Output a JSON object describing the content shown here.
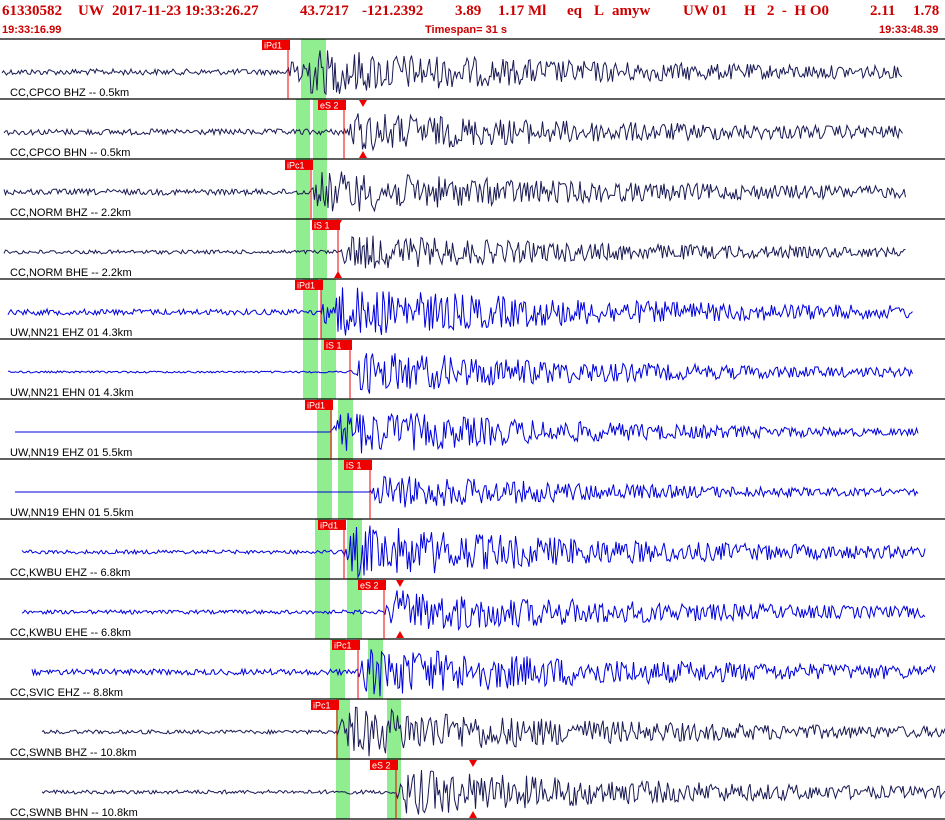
{
  "header": {
    "event_id": "61330582",
    "network": "UW",
    "origin_datetime": "2017-11-23 19:33:26.27",
    "latitude": "43.7217",
    "longitude": "-121.2392",
    "depth": "3.89",
    "magnitude": "1.17 Ml",
    "event_type": "eq",
    "location_flag": "L",
    "analyst": "amyw",
    "solution_source": "UW 01",
    "quality_fields": "H   2  -  H O0",
    "rms": "2.11",
    "erh": "1.78",
    "start_time": "19:33:16.99",
    "timespan": "Timespan=  31 s",
    "end_time": "19:33:48.39"
  },
  "colors": {
    "header_text": "#cc0000",
    "trace_bh": "#1a1a55",
    "trace_eh": "#0000dd",
    "pick_marker": "#ee0000",
    "pick_window": "#90ee90",
    "grid": "#000000"
  },
  "traces": [
    {
      "label": "CC,CPCO BHZ -- 0.5km",
      "type": "bh",
      "pick": "iPd1",
      "pick_kind": "P"
    },
    {
      "label": "CC,CPCO BHN -- 0.5km",
      "type": "bh",
      "pick": "eS 2",
      "pick_kind": "S"
    },
    {
      "label": "CC,NORM BHZ -- 2.2km",
      "type": "bh",
      "pick": "iPc1",
      "pick_kind": "P"
    },
    {
      "label": "CC,NORM BHE -- 2.2km",
      "type": "bh",
      "pick": "iS 1",
      "pick_kind": "S"
    },
    {
      "label": "UW,NN21 EHZ 01 4.3km",
      "type": "eh",
      "pick": "iPd1",
      "pick_kind": "P"
    },
    {
      "label": "UW,NN21 EHN 01 4.3km",
      "type": "eh",
      "pick": "iS 1",
      "pick_kind": "S"
    },
    {
      "label": "UW,NN19 EHZ 01 5.5km",
      "type": "eh",
      "pick": "iPd1",
      "pick_kind": "P"
    },
    {
      "label": "UW,NN19 EHN 01 5.5km",
      "type": "eh",
      "pick": "iS 1",
      "pick_kind": "S"
    },
    {
      "label": "CC,KWBU EHZ -- 6.8km",
      "type": "eh",
      "pick": "iPd1",
      "pick_kind": "P"
    },
    {
      "label": "CC,KWBU EHE -- 6.8km",
      "type": "eh",
      "pick": "eS 2",
      "pick_kind": "S"
    },
    {
      "label": "CC,SVIC EHZ -- 8.8km",
      "type": "eh",
      "pick": "iPc1",
      "pick_kind": "P"
    },
    {
      "label": "CC,SWNB BHZ -- 10.8km",
      "type": "bh",
      "pick": "iPc1",
      "pick_kind": "P"
    },
    {
      "label": "CC,SWNB BHN -- 10.8km",
      "type": "bh",
      "pick": "eS 2",
      "pick_kind": "S"
    }
  ]
}
